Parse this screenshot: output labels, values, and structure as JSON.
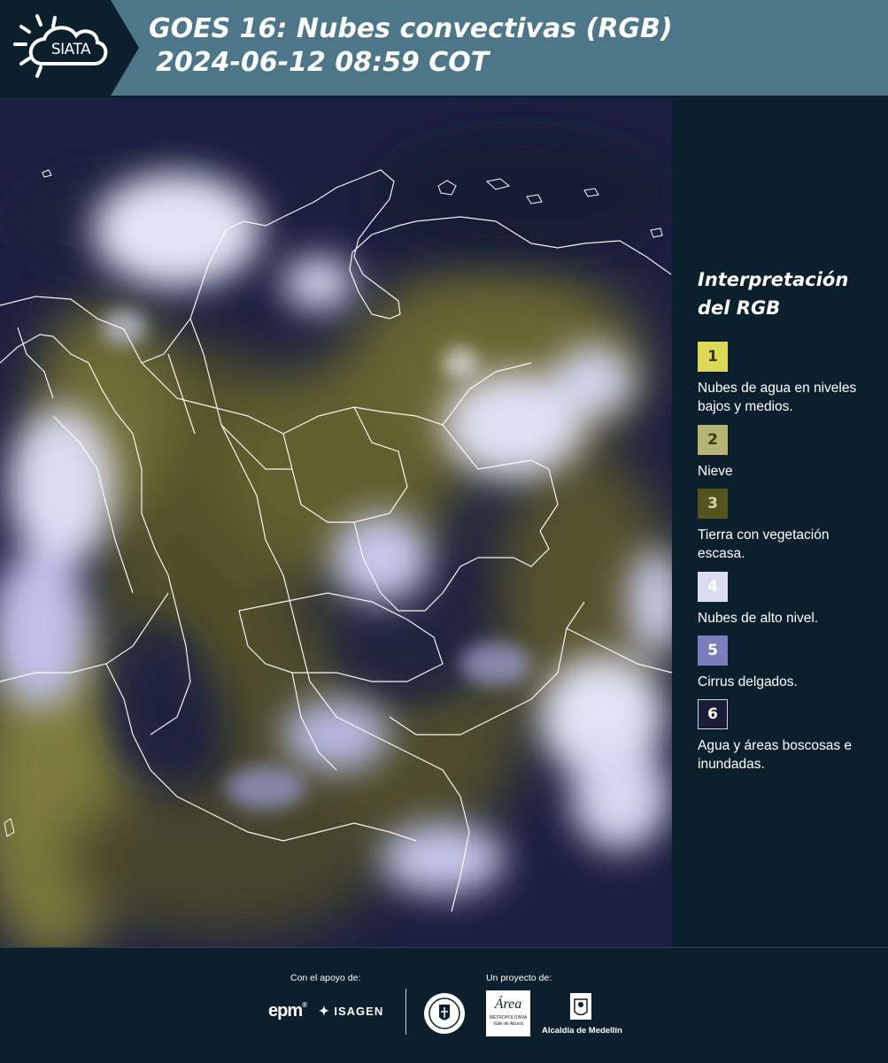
{
  "header": {
    "logo_text": "SIATA",
    "title_line1": "GOES 16: Nubes convectivas (RGB)",
    "title_line2": "2024-06-12 08:59 COT"
  },
  "legend": {
    "title_line1": "Interpretación",
    "title_line2": "del RGB",
    "items": [
      {
        "number": "1",
        "label": "Nubes de agua en niveles bajos y medios.",
        "color": "#dcd857"
      },
      {
        "number": "2",
        "label": "Nieve",
        "color": "#b5b474"
      },
      {
        "number": "3",
        "label": "Tierra con vegetación escasa.",
        "color": "#555420"
      },
      {
        "number": "4",
        "label": "Nubes de alto nivel.",
        "color": "#dcdcf0"
      },
      {
        "number": "5",
        "label": "Cirrus delgados.",
        "color": "#7b7dbd"
      },
      {
        "number": "6",
        "label": "Agua y áreas boscosas e inundadas.",
        "color": "#1a1d37"
      }
    ]
  },
  "footer": {
    "support_caption": "Con el apoyo de:",
    "project_caption": "Un proyecto de:",
    "sponsors": {
      "epm": "epm",
      "isagen": "ISAGEN",
      "area_metropolitana": "Área",
      "area_sub": "METROPOLITANA",
      "area_sub2": "Valle de Aburrá",
      "alcaldia": "Alcaldía de Medellín",
      "seal": "MEDELLÍN"
    }
  },
  "colors": {
    "header_bg": "#4d7788",
    "page_bg": "#0b202c",
    "map_bg": "#1b1f3d"
  }
}
